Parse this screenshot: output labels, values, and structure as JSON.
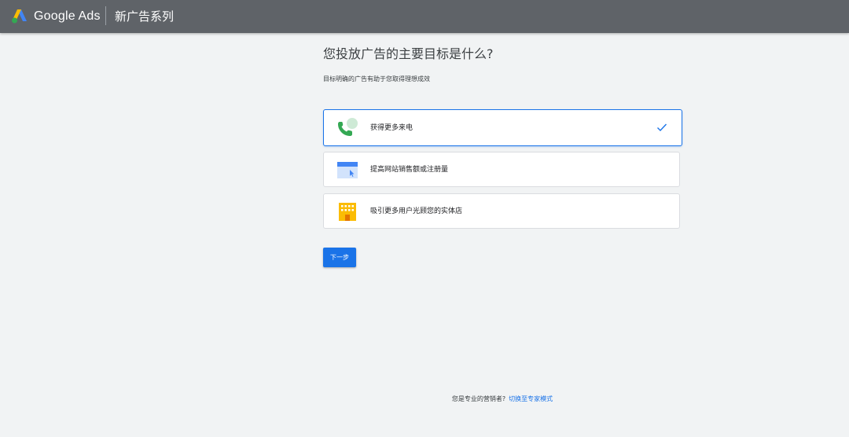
{
  "header": {
    "brand": "Google Ads",
    "campaign_title": "新广告系列"
  },
  "main": {
    "question": "您投放广告的主要目标是什么?",
    "subtitle": "目标明确的广告有助于您取得理想成效",
    "options": [
      {
        "label": "获得更多来电",
        "icon": "phone-call-icon",
        "selected": true
      },
      {
        "label": "提高网站销售额或注册量",
        "icon": "website-browser-icon",
        "selected": false
      },
      {
        "label": "吸引更多用户光顾您的实体店",
        "icon": "storefront-building-icon",
        "selected": false
      }
    ],
    "next_label": "下一步"
  },
  "footer": {
    "prompt": "您是专业的营销者?",
    "expert_link": "切换至专家模式"
  },
  "colors": {
    "topbar": "#5f6368",
    "background": "#f1f3f4",
    "accent": "#1a73e8",
    "phone_green": "#34a853",
    "bubble_green": "#ceead6",
    "browser_blue": "#4285f4",
    "store_yellow": "#fbbc04"
  }
}
